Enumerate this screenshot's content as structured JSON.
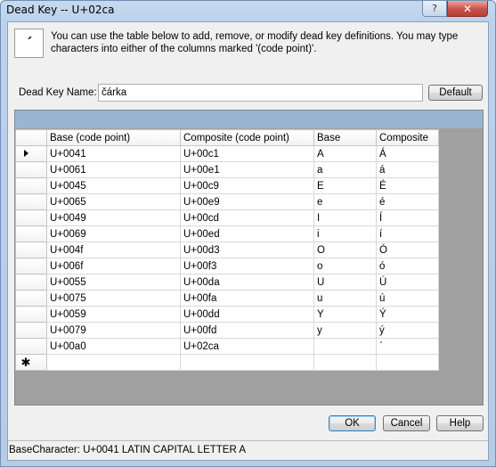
{
  "window": {
    "title": "Dead Key -- U+02ca",
    "help_glyph": "?",
    "close_glyph": "✕"
  },
  "info": {
    "icon_glyph": "ˊ",
    "text": "You can use the table below to add, remove, or modify dead key definitions. You may type characters into either of the columns marked '(code point)'."
  },
  "dead_key": {
    "label": "Dead Key Name:",
    "value": "čárka",
    "default_button": "Default"
  },
  "grid": {
    "columns": [
      "Base  (code point)",
      "Composite  (code point)",
      "Base",
      "Composite"
    ],
    "current_row_marker": "▶",
    "new_row_marker": "✱",
    "rows": [
      {
        "base_cp": "U+0041",
        "comp_cp": "U+00c1",
        "base": "A",
        "comp": "Á"
      },
      {
        "base_cp": "U+0061",
        "comp_cp": "U+00e1",
        "base": "a",
        "comp": "á"
      },
      {
        "base_cp": "U+0045",
        "comp_cp": "U+00c9",
        "base": "E",
        "comp": "É"
      },
      {
        "base_cp": "U+0065",
        "comp_cp": "U+00e9",
        "base": "e",
        "comp": "é"
      },
      {
        "base_cp": "U+0049",
        "comp_cp": "U+00cd",
        "base": "I",
        "comp": "Í"
      },
      {
        "base_cp": "U+0069",
        "comp_cp": "U+00ed",
        "base": "i",
        "comp": "í"
      },
      {
        "base_cp": "U+004f",
        "comp_cp": "U+00d3",
        "base": "O",
        "comp": "Ó"
      },
      {
        "base_cp": "U+006f",
        "comp_cp": "U+00f3",
        "base": "o",
        "comp": "ó"
      },
      {
        "base_cp": "U+0055",
        "comp_cp": "U+00da",
        "base": "U",
        "comp": "Ú"
      },
      {
        "base_cp": "U+0075",
        "comp_cp": "U+00fa",
        "base": "u",
        "comp": "ú"
      },
      {
        "base_cp": "U+0059",
        "comp_cp": "U+00dd",
        "base": "Y",
        "comp": "Ý"
      },
      {
        "base_cp": "U+0079",
        "comp_cp": "U+00fd",
        "base": "y",
        "comp": "ý"
      },
      {
        "base_cp": "U+00a0",
        "comp_cp": "U+02ca",
        "base": "",
        "comp": "ˊ"
      }
    ]
  },
  "buttons": {
    "ok": "OK",
    "cancel": "Cancel",
    "help": "Help"
  },
  "status": {
    "text": "BaseCharacter: U+0041   LATIN CAPITAL LETTER A"
  }
}
